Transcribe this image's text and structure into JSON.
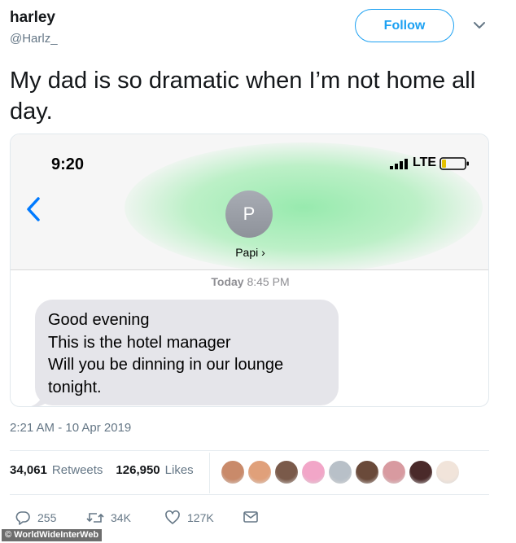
{
  "user": {
    "display_name": "harley",
    "handle": "@Harlz_"
  },
  "follow_label": "Follow",
  "tweet_text": "My dad is so dramatic when I’m not home all day.",
  "screenshot": {
    "status_time": "9:20",
    "network": "LTE",
    "avatar_letter": "P",
    "contact_name": "Papi ›",
    "day_label": "Today",
    "message_time": "8:45 PM",
    "message_lines": [
      "Good evening",
      "This is the hotel manager",
      "Will you be dinning in our lounge",
      "tonight."
    ]
  },
  "tweet_timestamp": "2:21 AM - 10 Apr 2019",
  "stats": {
    "retweets_count": "34,061",
    "retweets_label": "Retweets",
    "likes_count": "126,950",
    "likes_label": "Likes"
  },
  "liker_avatar_colors": [
    "#c98a6a",
    "#e0a07a",
    "#7a5a4a",
    "#f2a6c8",
    "#b8c0c8",
    "#6a4a3a",
    "#d89aa0",
    "#4a2a2a",
    "#f1e4da"
  ],
  "actions": {
    "replies": "255",
    "retweets": "34K",
    "likes": "127K"
  },
  "watermark": "© WorldWideInterWeb",
  "colors": {
    "accent": "#1da1f2",
    "secondary_text": "#657786",
    "ios_blue": "#007aff",
    "bubble": "#e5e5ea"
  }
}
